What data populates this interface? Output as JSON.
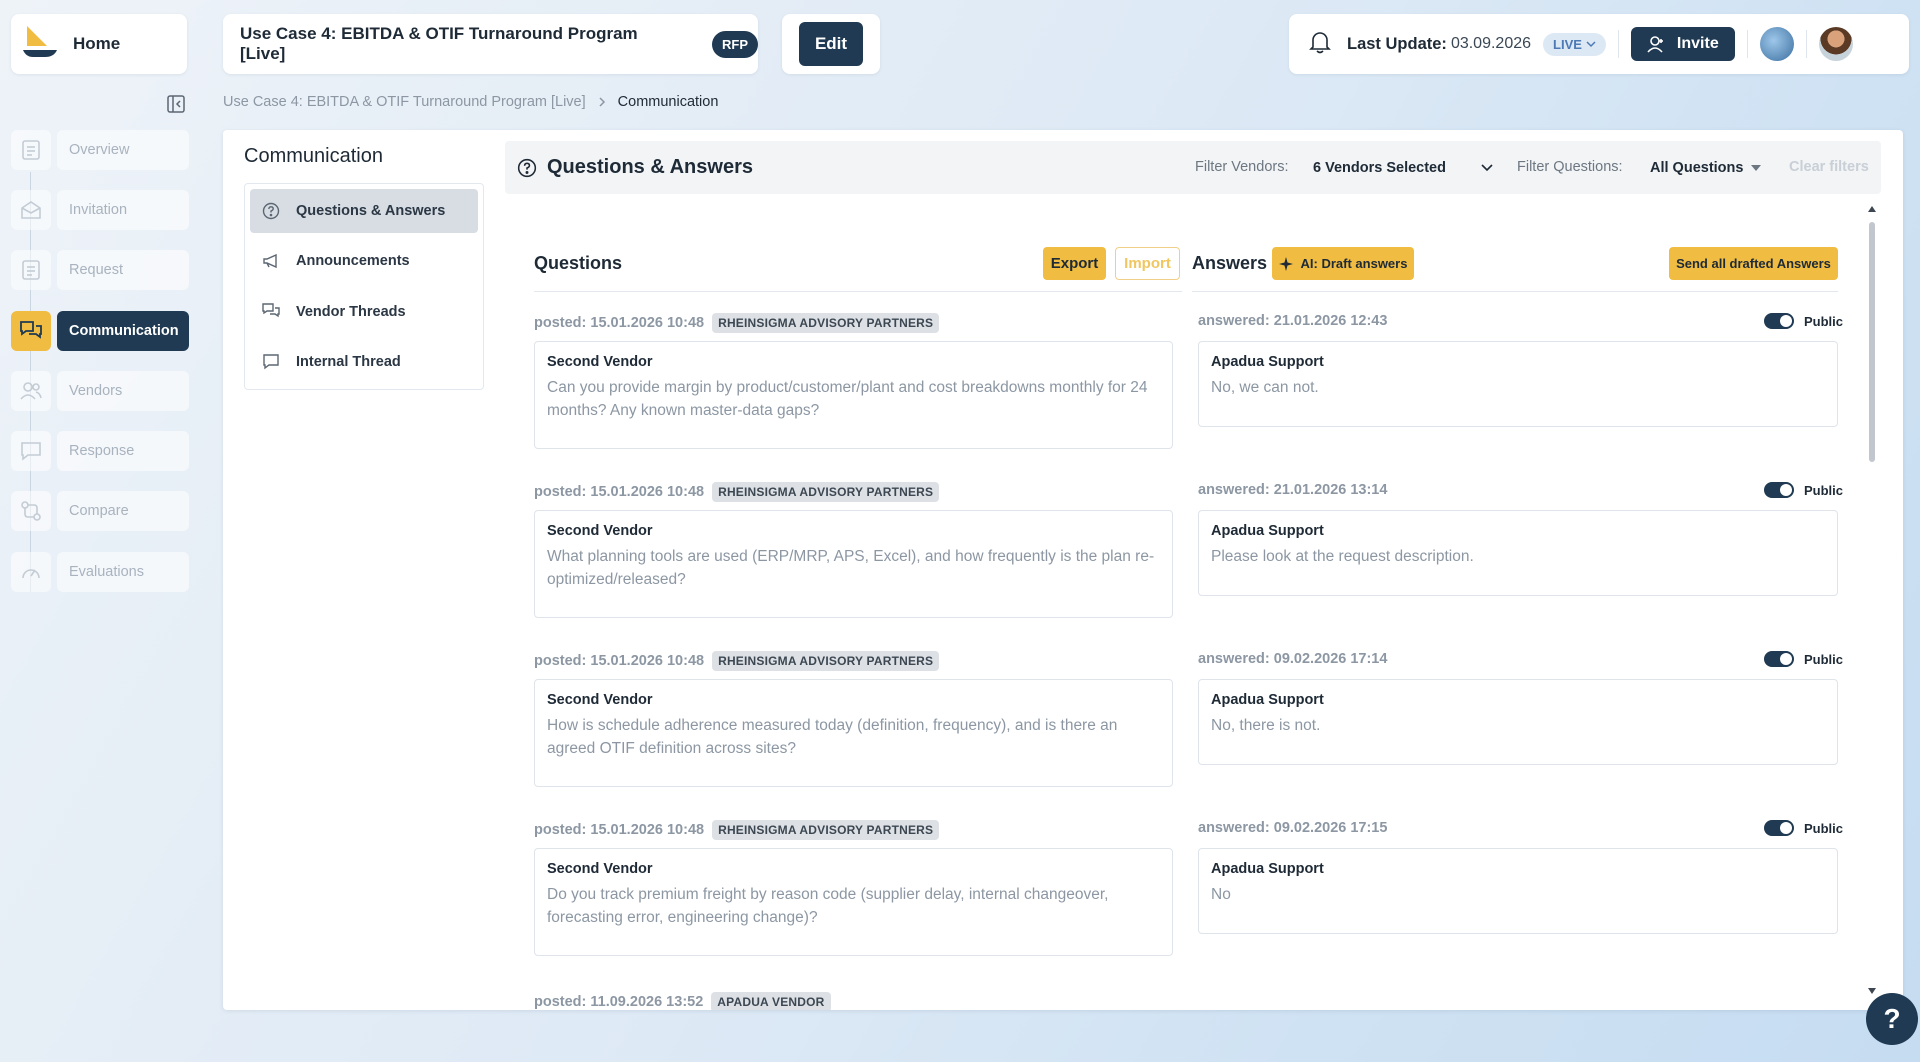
{
  "home": {
    "label": "Home"
  },
  "sidebar": {
    "items": [
      {
        "label": "Overview",
        "icon": "document-icon",
        "active": false
      },
      {
        "label": "Invitation",
        "icon": "envelope-icon",
        "active": false
      },
      {
        "label": "Request",
        "icon": "document-icon",
        "active": false
      },
      {
        "label": "Communication",
        "icon": "chat-icon",
        "active": true
      },
      {
        "label": "Vendors",
        "icon": "users-icon",
        "active": false
      },
      {
        "label": "Response",
        "icon": "message-icon",
        "active": false
      },
      {
        "label": "Compare",
        "icon": "compare-icon",
        "active": false
      },
      {
        "label": "Evaluations",
        "icon": "gauge-icon",
        "active": false
      }
    ]
  },
  "header": {
    "project_title": "Use Case 4: EBITDA & OTIF Turnaround Program [Live]",
    "type_badge": "RFP",
    "edit_label": "Edit",
    "last_update_label": "Last Update:",
    "last_update_date": "03.09.2026",
    "live_label": "LIVE",
    "invite_label": "Invite"
  },
  "breadcrumb": {
    "parent": "Use Case 4: EBITDA & OTIF Turnaround Program [Live]",
    "current": "Communication"
  },
  "communication": {
    "title": "Communication",
    "subnav": [
      {
        "label": "Questions & Answers",
        "icon": "question-circle-icon",
        "active": true
      },
      {
        "label": "Announcements",
        "icon": "megaphone-icon",
        "active": false
      },
      {
        "label": "Vendor Threads",
        "icon": "threads-icon",
        "active": false
      },
      {
        "label": "Internal Thread",
        "icon": "message-icon",
        "active": false
      }
    ]
  },
  "qa": {
    "title": "Questions & Answers",
    "filter_vendors_label": "Filter Vendors:",
    "filter_vendors_value": "6 Vendors Selected",
    "filter_questions_label": "Filter Questions:",
    "filter_questions_value": "All Questions",
    "clear_filters": "Clear filters",
    "questions_heading": "Questions",
    "export_label": "Export",
    "import_label": "Import",
    "answers_heading": "Answers",
    "ai_draft_label": "AI: Draft answers",
    "send_all_label": "Send all drafted Answers",
    "public_label": "Public",
    "entries": [
      {
        "posted": "posted: 15.01.2026 10:48",
        "vendor_tag": "RHEINSIGMA ADVISORY PARTNERS",
        "question_author": "Second Vendor",
        "question": "Can you provide margin by product/customer/plant and cost breakdowns monthly for 24 months? Any known master-data gaps?",
        "answered": "answered: 21.01.2026 12:43",
        "answer_author": "Apadua Support",
        "answer": "No, we can not."
      },
      {
        "posted": "posted: 15.01.2026 10:48",
        "vendor_tag": "RHEINSIGMA ADVISORY PARTNERS",
        "question_author": "Second Vendor",
        "question": "What planning tools are used (ERP/MRP, APS, Excel), and how frequently is the plan re-optimized/released?",
        "answered": "answered: 21.01.2026 13:14",
        "answer_author": "Apadua Support",
        "answer": "Please look at the request description."
      },
      {
        "posted": "posted: 15.01.2026 10:48",
        "vendor_tag": "RHEINSIGMA ADVISORY PARTNERS",
        "question_author": "Second Vendor",
        "question": "How is schedule adherence measured today (definition, frequency), and is there an agreed OTIF definition across sites?",
        "answered": "answered: 09.02.2026 17:14",
        "answer_author": "Apadua Support",
        "answer": "No, there is not."
      },
      {
        "posted": "posted: 15.01.2026 10:48",
        "vendor_tag": "RHEINSIGMA ADVISORY PARTNERS",
        "question_author": "Second Vendor",
        "question": "Do you track premium freight by reason code (supplier delay, internal changeover, forecasting error, engineering change)?",
        "answered": "answered: 09.02.2026 17:15",
        "answer_author": "Apadua Support",
        "answer": "No"
      }
    ],
    "partial_entry": {
      "posted": "posted: 11.09.2026 13:52",
      "vendor_tag": "APADUA VENDOR"
    }
  },
  "help": {
    "label": "?"
  }
}
